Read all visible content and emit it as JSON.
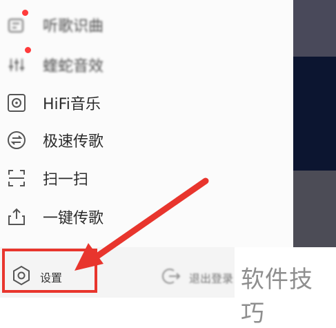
{
  "menu": {
    "items": [
      {
        "label": "听歌识曲",
        "icon": "recognize-icon",
        "blurred": true,
        "badge": true
      },
      {
        "label": "蝰蛇音效",
        "icon": "equalizer-icon",
        "blurred": true,
        "badge": true
      },
      {
        "label": "HiFi音乐",
        "icon": "hifi-icon",
        "blurred": false,
        "badge": false
      },
      {
        "label": "极速传歌",
        "icon": "transfer-icon",
        "blurred": false,
        "badge": false
      },
      {
        "label": "扫一扫",
        "icon": "scan-icon",
        "blurred": false,
        "badge": false
      },
      {
        "label": "一键传歌",
        "icon": "upload-icon",
        "blurred": false,
        "badge": false
      }
    ]
  },
  "footer": {
    "settings_label": "设置",
    "logout_label": "退出登录"
  },
  "watermark": "软件技巧",
  "colors": {
    "highlight": "#e8352d",
    "badge": "#ff3b3b",
    "text": "#2b2b2b"
  }
}
